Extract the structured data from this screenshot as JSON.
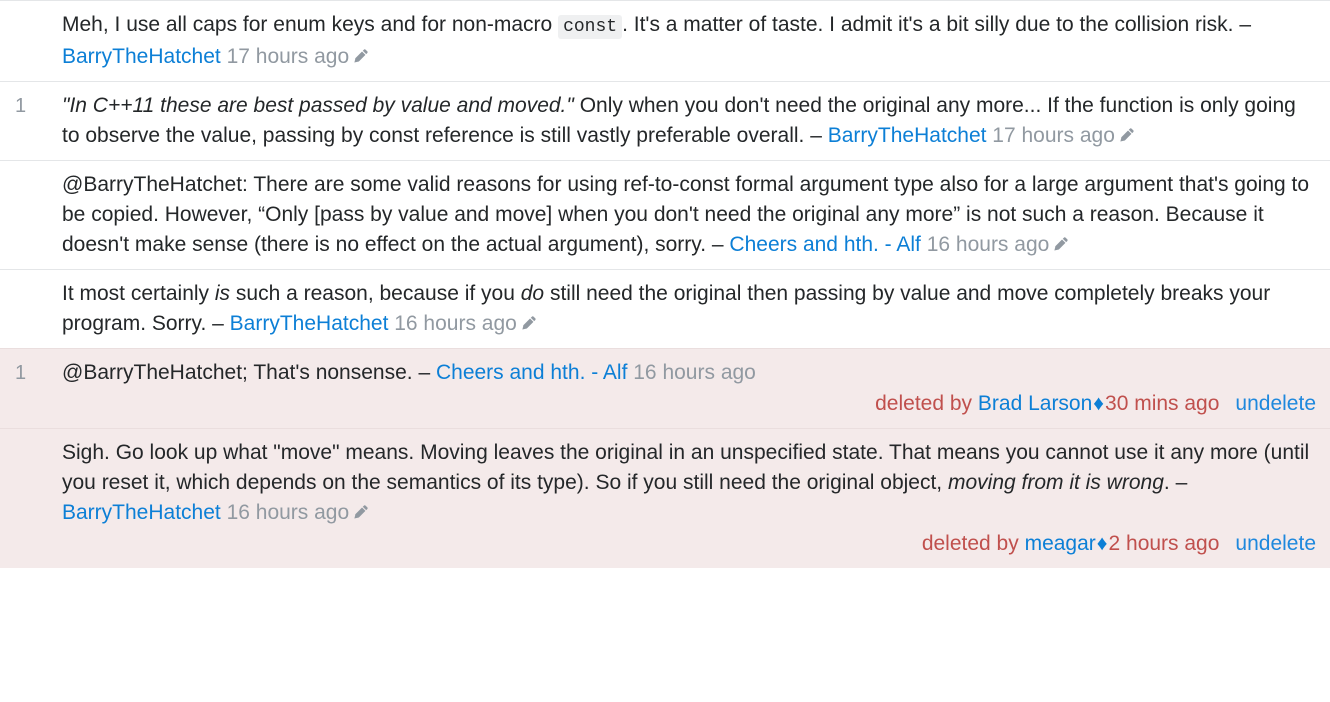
{
  "colors": {
    "link": "#0c7fd6",
    "muted": "#9199a1",
    "text": "#242729",
    "deleted_background": "#f4eaea",
    "deleted_text": "#c0504d",
    "separator": "#e4e6e8",
    "code_background": "#eff0f1"
  },
  "icons": {
    "edit": "edit-pencil-icon",
    "moderator_diamond": "♦"
  },
  "labels": {
    "undelete": "undelete",
    "deleted_by": "deleted by",
    "dash": "–"
  },
  "comments": [
    {
      "score": "",
      "deleted": false,
      "parts": [
        {
          "type": "text",
          "value": "Meh, I use all caps for enum keys and for non-macro "
        },
        {
          "type": "code",
          "value": "const"
        },
        {
          "type": "text",
          "value": ". It's a matter of taste. I admit it's a bit silly due to the collision risk. "
        },
        {
          "type": "dash",
          "value": "– "
        },
        {
          "type": "user",
          "value": "BarryTheHatchet"
        },
        {
          "type": "date",
          "value": " 17 hours ago"
        },
        {
          "type": "edit-icon",
          "value": "edit-pencil-icon"
        }
      ]
    },
    {
      "score": "1",
      "deleted": false,
      "parts": [
        {
          "type": "em",
          "value": "\"In C++11 these are best passed by value and moved.\""
        },
        {
          "type": "text",
          "value": " Only when you don't need the original any more... If the function is only going to observe the value, passing by const reference is still vastly preferable overall. "
        },
        {
          "type": "dash",
          "value": "– "
        },
        {
          "type": "user",
          "value": "BarryTheHatchet"
        },
        {
          "type": "date",
          "value": " 17 hours ago"
        },
        {
          "type": "edit-icon",
          "value": "edit-pencil-icon"
        }
      ]
    },
    {
      "score": "",
      "deleted": false,
      "parts": [
        {
          "type": "text",
          "value": "@BarryTheHatchet: There are some valid reasons for using ref-to-const formal argument type also for a large argument that's going to be copied. However, “Only [pass by value and move] when you don't need the original any more” is not such a reason. Because it doesn't make sense (there is no effect on the actual argument), sorry. "
        },
        {
          "type": "dash",
          "value": "– "
        },
        {
          "type": "user",
          "value": "Cheers and hth. - Alf"
        },
        {
          "type": "date",
          "value": " 16 hours ago"
        },
        {
          "type": "edit-icon",
          "value": "edit-pencil-icon"
        }
      ]
    },
    {
      "score": "",
      "deleted": false,
      "parts": [
        {
          "type": "text",
          "value": "It most certainly "
        },
        {
          "type": "em",
          "value": "is"
        },
        {
          "type": "text",
          "value": " such a reason, because if you "
        },
        {
          "type": "em",
          "value": "do"
        },
        {
          "type": "text",
          "value": " still need the original then passing by value and move completely breaks your program. Sorry. "
        },
        {
          "type": "dash",
          "value": "– "
        },
        {
          "type": "user",
          "value": "BarryTheHatchet"
        },
        {
          "type": "date",
          "value": " 16 hours ago"
        },
        {
          "type": "edit-icon",
          "value": "edit-pencil-icon"
        }
      ]
    },
    {
      "score": "1",
      "deleted": true,
      "parts": [
        {
          "type": "text",
          "value": "@BarryTheHatchet; That's nonsense. "
        },
        {
          "type": "dash",
          "value": "– "
        },
        {
          "type": "user",
          "value": "Cheers and hth. - Alf"
        },
        {
          "type": "date",
          "value": " 16 hours ago"
        }
      ],
      "deleted_by": {
        "prefix": "deleted by",
        "user": "Brad Larson",
        "diamond": "♦",
        "time": "30 mins ago",
        "action": "undelete"
      }
    },
    {
      "score": "",
      "deleted": true,
      "parts": [
        {
          "type": "text",
          "value": "Sigh. Go look up what \"move\" means. Moving leaves the original in an unspecified state. That means you cannot use it any more (until you reset it, which depends on the semantics of its type). So if you still need the original object, "
        },
        {
          "type": "em",
          "value": "moving from it is wrong"
        },
        {
          "type": "text",
          "value": ". "
        },
        {
          "type": "dash",
          "value": "– "
        },
        {
          "type": "user",
          "value": "BarryTheHatchet"
        },
        {
          "type": "date",
          "value": " 16 hours ago"
        },
        {
          "type": "edit-icon",
          "value": "edit-pencil-icon"
        }
      ],
      "deleted_by": {
        "prefix": "deleted by",
        "user": "meagar",
        "diamond": "♦",
        "time": "2 hours ago",
        "action": "undelete"
      }
    }
  ]
}
